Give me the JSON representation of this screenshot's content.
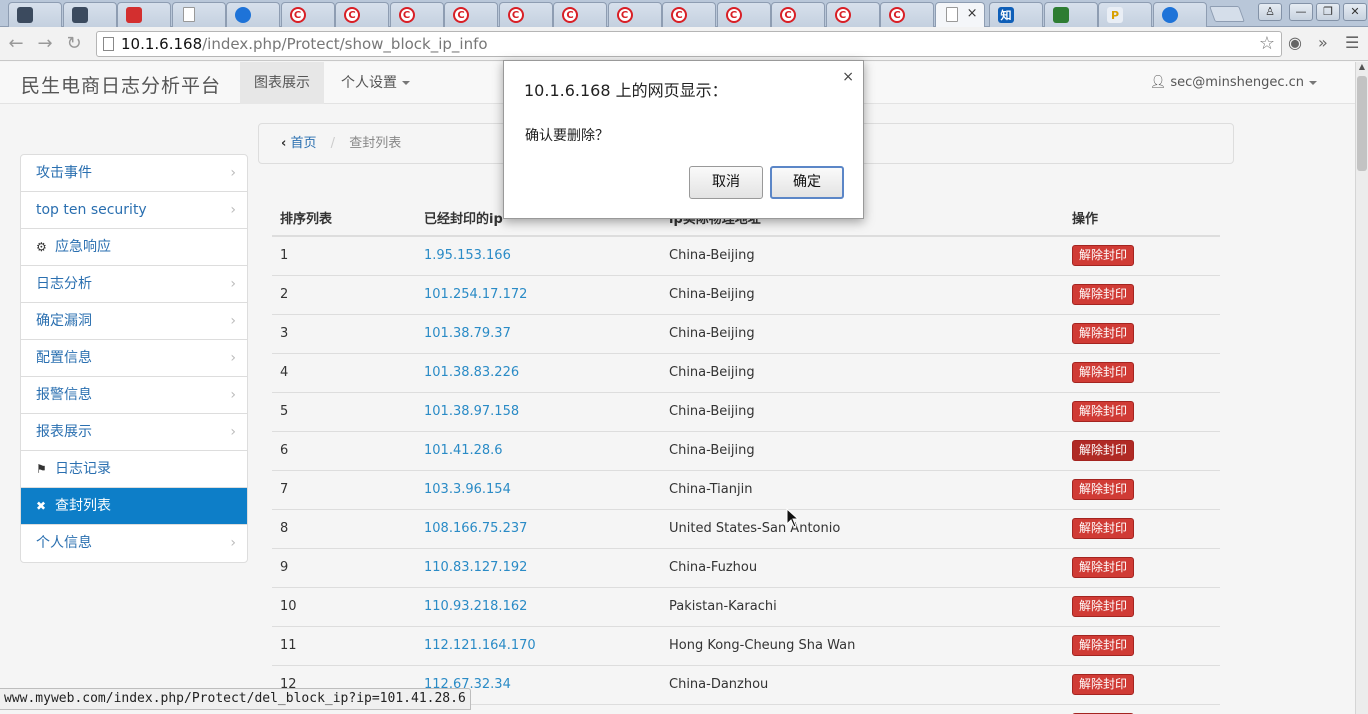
{
  "browser": {
    "tabs": [
      {
        "icon": "dark-square-icon",
        "glyph": "",
        "style": "dark"
      },
      {
        "icon": "dark-square-icon",
        "glyph": "",
        "style": "dark"
      },
      {
        "icon": "red-grid-icon",
        "glyph": "",
        "style": "red"
      },
      {
        "icon": "page-icon",
        "glyph": "",
        "style": "page"
      },
      {
        "icon": "blue-circle-icon",
        "glyph": "",
        "style": "blue"
      },
      {
        "icon": "red-c-icon",
        "glyph": "C",
        "style": "redc"
      },
      {
        "icon": "red-c-icon",
        "glyph": "C",
        "style": "redc"
      },
      {
        "icon": "red-c-icon",
        "glyph": "C",
        "style": "redc"
      },
      {
        "icon": "red-c-icon",
        "glyph": "C",
        "style": "redc"
      },
      {
        "icon": "red-c-icon",
        "glyph": "C",
        "style": "redc"
      },
      {
        "icon": "red-c-icon",
        "glyph": "C",
        "style": "redc"
      },
      {
        "icon": "red-c-icon",
        "glyph": "C",
        "style": "redc"
      },
      {
        "icon": "red-c-icon",
        "glyph": "C",
        "style": "redc"
      },
      {
        "icon": "red-c-icon",
        "glyph": "C",
        "style": "redc"
      },
      {
        "icon": "red-c-icon",
        "glyph": "C",
        "style": "redc"
      },
      {
        "icon": "red-c-icon",
        "glyph": "C",
        "style": "redc"
      },
      {
        "icon": "red-c-icon",
        "glyph": "C",
        "style": "redc"
      },
      {
        "icon": "page-icon",
        "glyph": "",
        "style": "page",
        "active": true
      },
      {
        "icon": "zhihu-icon",
        "glyph": "知",
        "style": "zhi"
      },
      {
        "icon": "green-app-icon",
        "glyph": "",
        "style": "green"
      },
      {
        "icon": "baidu-icon",
        "glyph": "P",
        "style": "baidu"
      },
      {
        "icon": "blue-circle-icon",
        "glyph": "",
        "style": "blue"
      }
    ],
    "url_host": "10.1.6.168",
    "url_path": "/index.php/Protect/show_block_ip_info",
    "status_url": "www.myweb.com/index.php/Protect/del_block_ip?ip=101.41.28.6"
  },
  "app": {
    "brand": "民生电商日志分析平台",
    "nav": {
      "charts": "图表展示",
      "personal_settings": "个人设置"
    },
    "user": "sec@minshengec.cn"
  },
  "sidebar": {
    "items": [
      {
        "label": "攻击事件",
        "kind": "chevron"
      },
      {
        "label": "top ten security",
        "kind": "chevron"
      },
      {
        "label": "应急响应",
        "kind": "gear"
      },
      {
        "label": "日志分析",
        "kind": "chevron"
      },
      {
        "label": "确定漏洞",
        "kind": "chevron"
      },
      {
        "label": "配置信息",
        "kind": "chevron"
      },
      {
        "label": "报警信息",
        "kind": "chevron"
      },
      {
        "label": "报表展示",
        "kind": "chevron"
      },
      {
        "label": "日志记录",
        "kind": "bookmark"
      },
      {
        "label": "查封列表",
        "kind": "close",
        "active": true
      },
      {
        "label": "个人信息",
        "kind": "chevron"
      }
    ]
  },
  "breadcrumb": {
    "home": "首页",
    "current": "查封列表"
  },
  "table": {
    "headers": {
      "index": "排序列表",
      "ip": "已经封印的ip",
      "location": "ip实际物理地址",
      "action": "操作"
    },
    "action_label": "解除封印",
    "rows": [
      {
        "index": "1",
        "ip": "1.95.153.166",
        "location": "China-Beijing"
      },
      {
        "index": "2",
        "ip": "101.254.17.172",
        "location": "China-Beijing"
      },
      {
        "index": "3",
        "ip": "101.38.79.37",
        "location": "China-Beijing"
      },
      {
        "index": "4",
        "ip": "101.38.83.226",
        "location": "China-Beijing"
      },
      {
        "index": "5",
        "ip": "101.38.97.158",
        "location": "China-Beijing"
      },
      {
        "index": "6",
        "ip": "101.41.28.6",
        "location": "China-Beijing",
        "hover": true
      },
      {
        "index": "7",
        "ip": "103.3.96.154",
        "location": "China-Tianjin"
      },
      {
        "index": "8",
        "ip": "108.166.75.237",
        "location": "United States-San Antonio"
      },
      {
        "index": "9",
        "ip": "110.83.127.192",
        "location": "China-Fuzhou"
      },
      {
        "index": "10",
        "ip": "110.93.218.162",
        "location": "Pakistan-Karachi"
      },
      {
        "index": "11",
        "ip": "112.121.164.170",
        "location": "Hong Kong-Cheung Sha Wan"
      },
      {
        "index": "12",
        "ip": "112.67.32.34",
        "location": "China-Danzhou"
      },
      {
        "index": "",
        "ip": "",
        "location": ""
      }
    ]
  },
  "dialog": {
    "title": "10.1.6.168 上的网页显示：",
    "message": "确认要删除？",
    "cancel": "取消",
    "ok": "确定",
    "close": "×"
  }
}
